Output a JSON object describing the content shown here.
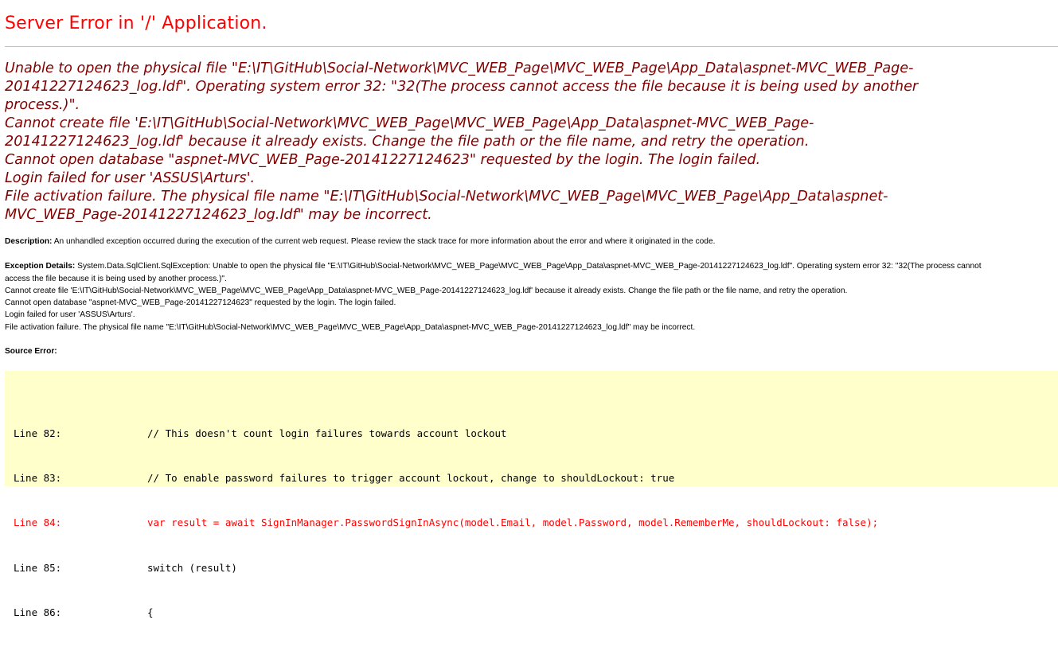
{
  "title": "Server Error in '/' Application.",
  "message_lines": [
    "Unable to open the physical file \"E:\\IT\\GitHub\\Social-Network\\MVC_WEB_Page\\MVC_WEB_Page\\App_Data\\aspnet-MVC_WEB_Page-",
    "20141227124623_log.ldf\". Operating system error 32: \"32(The process cannot access the file because it is being used by another",
    "process.)\".",
    "Cannot create file 'E:\\IT\\GitHub\\Social-Network\\MVC_WEB_Page\\MVC_WEB_Page\\App_Data\\aspnet-MVC_WEB_Page-",
    "20141227124623_log.ldf' because it already exists. Change the file path or the file name, and retry the operation.",
    "Cannot open database \"aspnet-MVC_WEB_Page-20141227124623\" requested by the login. The login failed.",
    "Login failed for user 'ASSUS\\Arturs'.",
    "File activation failure. The physical file name \"E:\\IT\\GitHub\\Social-Network\\MVC_WEB_Page\\MVC_WEB_Page\\App_Data\\aspnet-",
    "MVC_WEB_Page-20141227124623_log.ldf\" may be incorrect."
  ],
  "description": {
    "label": "Description:",
    "text": " An unhandled exception occurred during the execution of the current web request. Please review the stack trace for more information about the error and where it originated in the code."
  },
  "exception_details": {
    "label": "Exception Details:",
    "first_line": " System.Data.SqlClient.SqlException: Unable to open the physical file \"E:\\IT\\GitHub\\Social-Network\\MVC_WEB_Page\\MVC_WEB_Page\\App_Data\\aspnet-MVC_WEB_Page-20141227124623_log.ldf\". Operating system error 32: \"32(The process cannot",
    "lines": [
      "access the file because it is being used by another process.)\".",
      "Cannot create file 'E:\\IT\\GitHub\\Social-Network\\MVC_WEB_Page\\MVC_WEB_Page\\App_Data\\aspnet-MVC_WEB_Page-20141227124623_log.ldf' because it already exists. Change the file path or the file name, and retry the operation.",
      "Cannot open database \"aspnet-MVC_WEB_Page-20141227124623\" requested by the login. The login failed.",
      "Login failed for user 'ASSUS\\Arturs'.",
      "File activation failure. The physical file name \"E:\\IT\\GitHub\\Social-Network\\MVC_WEB_Page\\MVC_WEB_Page\\App_Data\\aspnet-MVC_WEB_Page-20141227124623_log.ldf\" may be incorrect."
    ]
  },
  "source_error": {
    "label": "Source Error:",
    "lines": [
      {
        "num": "Line 82:",
        "code": "// This doesn't count login failures towards account lockout",
        "error": false
      },
      {
        "num": "Line 83:",
        "code": "// To enable password failures to trigger account lockout, change to shouldLockout: true",
        "error": false
      },
      {
        "num": "Line 84:",
        "code": "var result = await SignInManager.PasswordSignInAsync(model.Email, model.Password, model.RememberMe, shouldLockout: false);",
        "error": true
      },
      {
        "num": "Line 85:",
        "code": "switch (result)",
        "error": false
      },
      {
        "num": "Line 86:",
        "code": "{",
        "error": false
      }
    ]
  },
  "colors": {
    "title": "#ff0000",
    "message": "#800000",
    "source_background": "#ffffcc",
    "error_line": "#ff0000"
  }
}
